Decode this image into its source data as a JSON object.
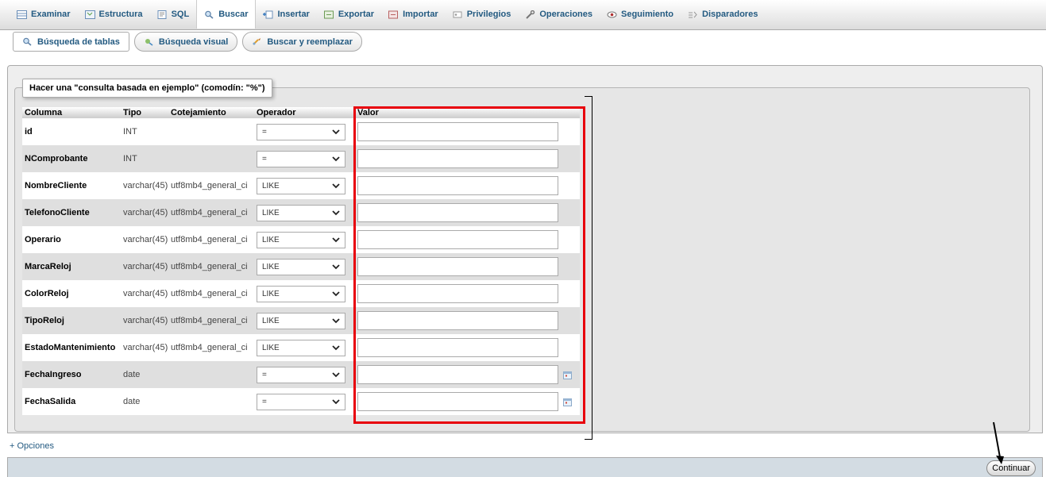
{
  "top_tabs": [
    {
      "label": "Examinar",
      "icon": "table-browse-icon"
    },
    {
      "label": "Estructura",
      "icon": "structure-icon"
    },
    {
      "label": "SQL",
      "icon": "sql-icon"
    },
    {
      "label": "Buscar",
      "icon": "search-icon",
      "active": true
    },
    {
      "label": "Insertar",
      "icon": "insert-icon"
    },
    {
      "label": "Exportar",
      "icon": "export-icon"
    },
    {
      "label": "Importar",
      "icon": "import-icon"
    },
    {
      "label": "Privilegios",
      "icon": "privileges-icon"
    },
    {
      "label": "Operaciones",
      "icon": "wrench-icon"
    },
    {
      "label": "Seguimiento",
      "icon": "eye-icon"
    },
    {
      "label": "Disparadores",
      "icon": "triggers-icon"
    }
  ],
  "sub_tabs": [
    {
      "label": "Búsqueda de tablas",
      "active": true
    },
    {
      "label": "Búsqueda visual"
    },
    {
      "label": "Buscar y reemplazar"
    }
  ],
  "legend": "Hacer una \"consulta basada en ejemplo\" (comodín: \"%\")",
  "table": {
    "headers": {
      "column": "Columna",
      "type": "Tipo",
      "collation": "Cotejamiento",
      "operator": "Operador",
      "value": "Valor"
    },
    "rows": [
      {
        "name": "id",
        "type": "INT",
        "collation": "",
        "operator": "=",
        "value": "",
        "calendar": false
      },
      {
        "name": "NComprobante",
        "type": "INT",
        "collation": "",
        "operator": "=",
        "value": "",
        "calendar": false
      },
      {
        "name": "NombreCliente",
        "type": "varchar(45)",
        "collation": "utf8mb4_general_ci",
        "operator": "LIKE",
        "value": "",
        "calendar": false
      },
      {
        "name": "TelefonoCliente",
        "type": "varchar(45)",
        "collation": "utf8mb4_general_ci",
        "operator": "LIKE",
        "value": "",
        "calendar": false
      },
      {
        "name": "Operario",
        "type": "varchar(45)",
        "collation": "utf8mb4_general_ci",
        "operator": "LIKE",
        "value": "",
        "calendar": false
      },
      {
        "name": "MarcaReloj",
        "type": "varchar(45)",
        "collation": "utf8mb4_general_ci",
        "operator": "LIKE",
        "value": "",
        "calendar": false
      },
      {
        "name": "ColorReloj",
        "type": "varchar(45)",
        "collation": "utf8mb4_general_ci",
        "operator": "LIKE",
        "value": "",
        "calendar": false
      },
      {
        "name": "TipoReloj",
        "type": "varchar(45)",
        "collation": "utf8mb4_general_ci",
        "operator": "LIKE",
        "value": "",
        "calendar": false
      },
      {
        "name": "EstadoMantenimiento",
        "type": "varchar(45)",
        "collation": "utf8mb4_general_ci",
        "operator": "LIKE",
        "value": "",
        "calendar": false
      },
      {
        "name": "FechaIngreso",
        "type": "date",
        "collation": "",
        "operator": "=",
        "value": "",
        "calendar": true
      },
      {
        "name": "FechaSalida",
        "type": "date",
        "collation": "",
        "operator": "=",
        "value": "",
        "calendar": true
      }
    ]
  },
  "options_link": "+ Opciones",
  "continue_button": "Continuar",
  "colors": {
    "link": "#235a81",
    "highlight": "#e8000b",
    "footer": "#d3dce3"
  }
}
